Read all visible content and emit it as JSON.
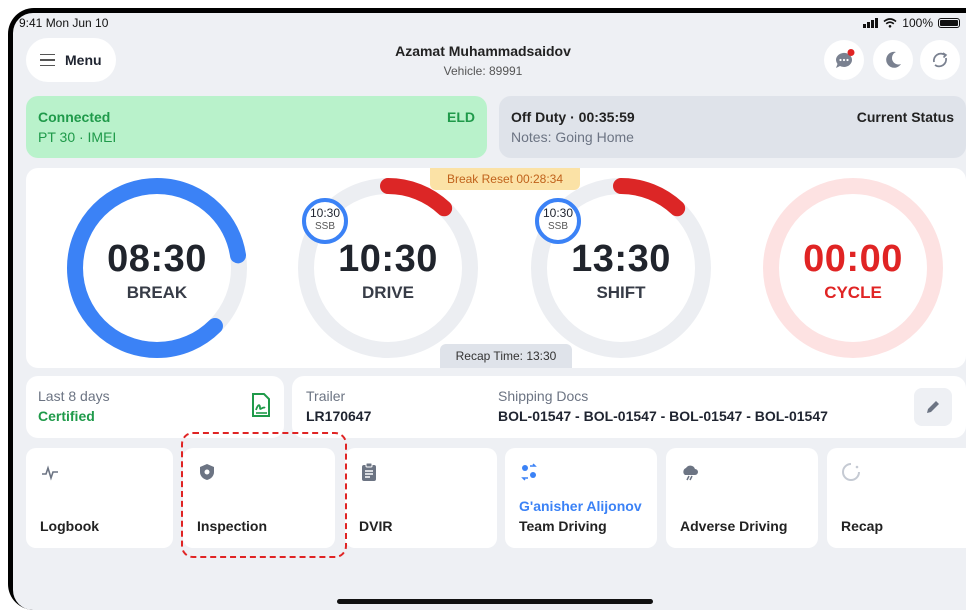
{
  "status_bar": {
    "time": "9:41  Mon Jun 10",
    "battery": "100%"
  },
  "header": {
    "menu_label": "Menu",
    "driver_name": "Azamat Muhammadsaidov",
    "vehicle": "Vehicle: 89991",
    "icons": [
      "chat-notification-icon",
      "moon-icon",
      "sync-icon"
    ]
  },
  "connection": {
    "status": "Connected",
    "eld": "ELD",
    "detail": "PT 30 · IMEI"
  },
  "duty": {
    "status": "Off Duty · 00:35:59",
    "label": "Current Status",
    "notes": "Notes: Going Home"
  },
  "gauges": {
    "break_reset": "Break Reset  00:28:34",
    "recap_time": "Recap Time: 13:30",
    "items": [
      {
        "value": "08:30",
        "label": "BREAK",
        "progress": 0.85,
        "color": "#3b82f6"
      },
      {
        "value": "10:30",
        "label": "DRIVE",
        "ssb": "10:30",
        "ssb_label": "SSB",
        "progress": 0.12,
        "color": "#dc2626"
      },
      {
        "value": "13:30",
        "label": "SHIFT",
        "ssb": "10:30",
        "ssb_label": "SSB",
        "progress": 0.12,
        "color": "#dc2626"
      },
      {
        "value": "00:00",
        "label": "CYCLE",
        "progress": 1.0,
        "color": "#fbd0d0"
      }
    ]
  },
  "certification": {
    "label": "Last 8 days",
    "status": "Certified"
  },
  "trailer": {
    "label": "Trailer",
    "value": "LR170647",
    "docs_label": "Shipping Docs",
    "docs_value": "BOL-01547 - BOL-01547 - BOL-01547 - BOL-01547"
  },
  "tiles": [
    {
      "label": "Logbook",
      "icon": "pulse-icon"
    },
    {
      "label": "Inspection",
      "icon": "shield-icon"
    },
    {
      "label": "DVIR",
      "icon": "clipboard-icon"
    },
    {
      "label": "Team Driving",
      "sublabel": "G'anisher Alijonov",
      "icon": "team-icon"
    },
    {
      "label": "Adverse Driving",
      "icon": "storm-cloud-icon"
    },
    {
      "label": "Recap",
      "icon": "loading-circle-icon"
    }
  ]
}
